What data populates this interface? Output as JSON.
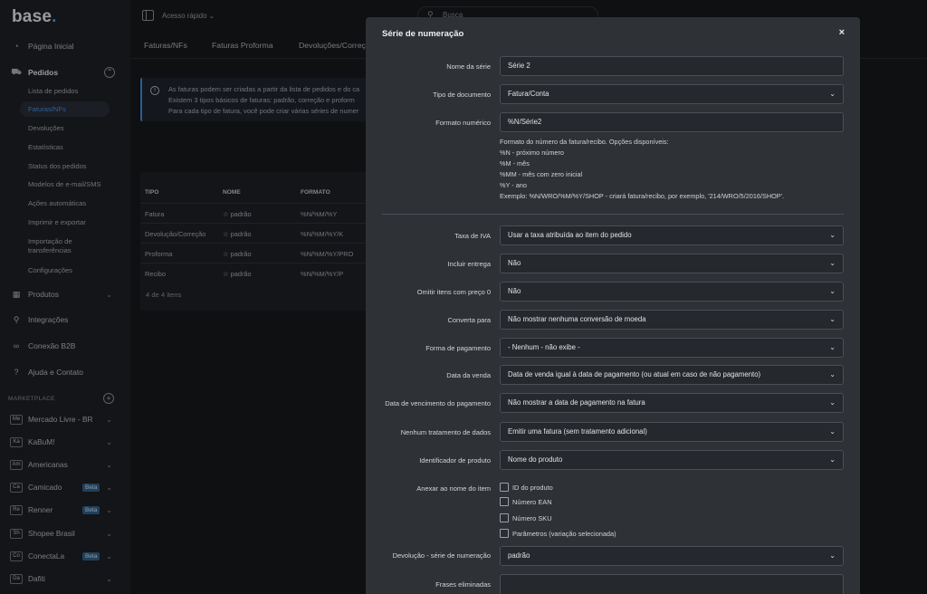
{
  "app": {
    "logo": "base",
    "logo_dot": "."
  },
  "sidebar": {
    "main": [
      {
        "label": "Página Inicial",
        "icon": "gauge-icon"
      },
      {
        "label": "Pedidos",
        "icon": "cart-icon"
      },
      {
        "label": "Produtos",
        "icon": "box-icon"
      },
      {
        "label": "Integrações",
        "icon": "plug-icon"
      },
      {
        "label": "Conexão B2B",
        "icon": "link-icon"
      },
      {
        "label": "Ajuda e Contato",
        "icon": "help-icon"
      }
    ],
    "pedidos_sub": [
      "Lista de pedidos",
      "Faturas/NFs",
      "Devoluções",
      "Estatísticas",
      "Status dos pedidos",
      "Modelos de e-mail/SMS",
      "Ações automáticas",
      "Imprimir e exportar",
      "Importação de",
      "transferências",
      "Configurações"
    ],
    "marketplace_title": "MARKETPLACE",
    "marketplace": [
      {
        "abbr": "Me",
        "label": "Mercado Livre - BR"
      },
      {
        "abbr": "Ka",
        "label": "KaBuM!"
      },
      {
        "abbr": "Am",
        "label": "Americanas"
      },
      {
        "abbr": "Ca",
        "label": "Camicado",
        "badge": "Beta"
      },
      {
        "abbr": "Re",
        "label": "Renner",
        "badge": "Beta"
      },
      {
        "abbr": "Sh",
        "label": "Shopee Brasil"
      },
      {
        "abbr": "Co",
        "label": "ConectaLa",
        "badge": "Beta"
      },
      {
        "abbr": "Da",
        "label": "Dafiti"
      }
    ]
  },
  "topbar": {
    "quick_access": "Acesso rápido",
    "search_placeholder": "Busca"
  },
  "tabs": [
    "Faturas/NFs",
    "Faturas Proforma",
    "Devoluções/Correçõ"
  ],
  "info": {
    "lines": [
      "As faturas podem ser criadas a partir da lista de pedidos e do ca",
      "Existem 3 tipos básicos de faturas: padrão, correção e proform",
      "Para cada tipo de fatura, você pode criar várias séries de numer"
    ]
  },
  "table": {
    "headers": [
      "TIPO",
      "NOME",
      "FORMATO"
    ],
    "rows": [
      [
        "Fatura",
        "padrão",
        "%N/%M/%Y"
      ],
      [
        "Devolução/Correção",
        "padrão",
        "%N/%M/%Y/K"
      ],
      [
        "Proforma",
        "padrão",
        "%N/%M/%Y/PRO"
      ],
      [
        "Recibo",
        "padrão",
        "%N/%M/%Y/P"
      ]
    ],
    "count": "4 de 4 itens"
  },
  "modal": {
    "title": "Série de numeração",
    "close": "×",
    "labels": {
      "nome": "Nome da série",
      "tipo": "Tipo de documento",
      "formato": "Formato numérico",
      "iva": "Taxa de IVA",
      "entrega": "Incluir entrega",
      "omitir": "Omitir itens com preço 0",
      "converta": "Converta para",
      "pagamento": "Forma de pagamento",
      "data_venda": "Data da venda",
      "vencimento": "Data de vencimento do pagamento",
      "tratamento": "Nenhum tratamento de dados",
      "identificador": "Identificador de produto",
      "anexar": "Anexar ao nome do item",
      "devolucao": "Devolução - série de numeração",
      "frases": "Frases eliminadas"
    },
    "values": {
      "nome": "Série 2",
      "tipo": "Fatura/Conta",
      "formato": "%N/Série2",
      "iva": "Usar a taxa atribuída ao item do pedido",
      "entrega": "Não",
      "omitir": "Não",
      "converta": "Não mostrar nenhuma conversão de moeda",
      "pagamento": "- Nenhum - não exibe -",
      "data_venda": "Data de venda igual à data de pagamento (ou atual em caso de não pagamento)",
      "vencimento": "Não mostrar a data de pagamento na fatura",
      "tratamento": "Emitir uma fatura (sem tratamento adicional)",
      "identificador": "Nome do produto",
      "devolucao": "padrão",
      "frases": ""
    },
    "help_lines": [
      "Formato do número da fatura/recibo. Opções disponíveis:",
      "%N - próximo número",
      "%M - mês",
      "%MM - mês com zero inicial",
      "%Y - ano",
      "Exemplo: %N/WRO/%M/%Y/SHOP - criará fatura/recibo, por exemplo, '214/WRO/5/2016/SHOP'."
    ],
    "checkboxes": [
      "ID do produto",
      "Número EAN",
      "Número SKU",
      "Parâmetros (variação selecionada)"
    ]
  }
}
